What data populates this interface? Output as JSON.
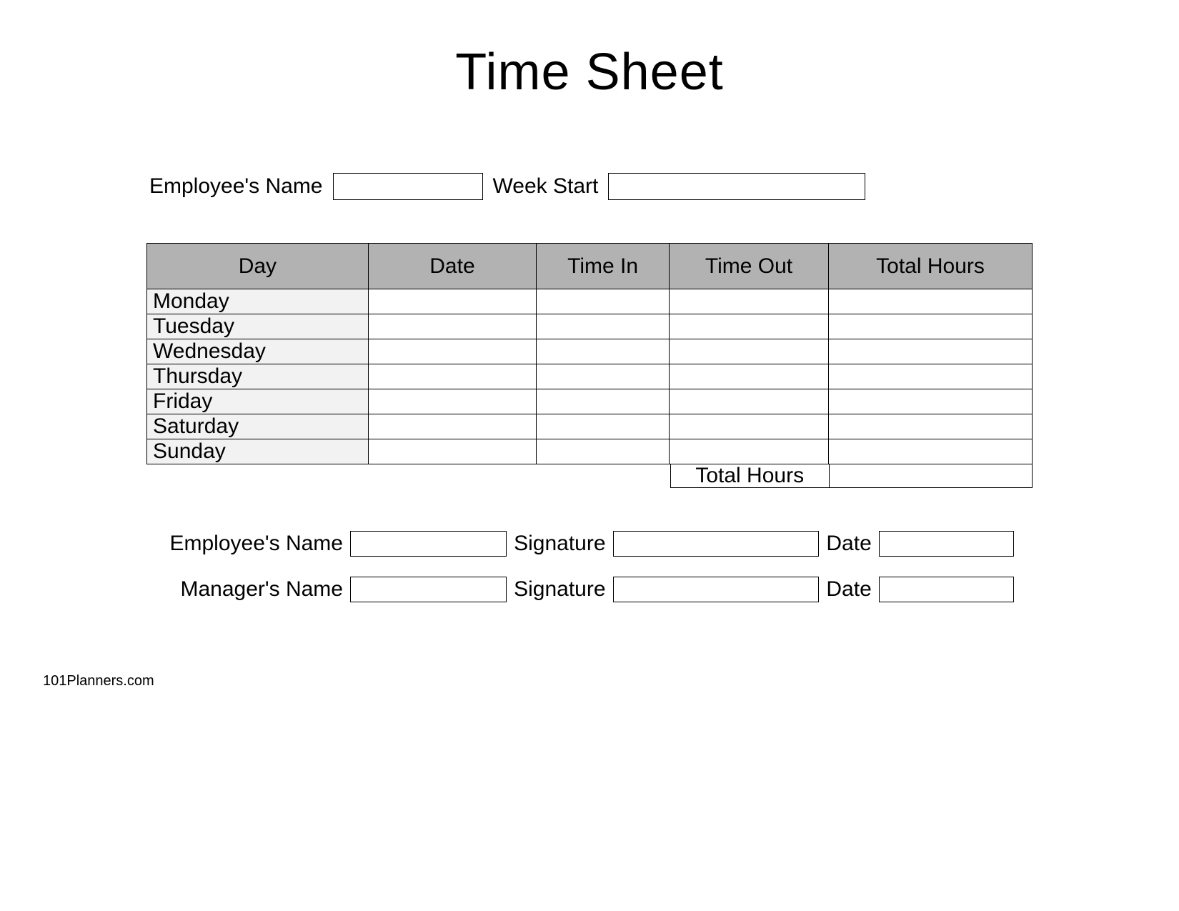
{
  "title": "Time Sheet",
  "header": {
    "employee_name_label": "Employee's Name",
    "week_start_label": "Week Start"
  },
  "table": {
    "columns": {
      "day": "Day",
      "date": "Date",
      "time_in": "Time In",
      "time_out": "Time Out",
      "total_hours": "Total Hours"
    },
    "days": [
      "Monday",
      "Tuesday",
      "Wednesday",
      "Thursday",
      "Friday",
      "Saturday",
      "Sunday"
    ],
    "totals_label": "Total Hours"
  },
  "signoff": {
    "employee_name_label": "Employee's Name",
    "manager_name_label": "Manager's Name",
    "signature_label": "Signature",
    "date_label": "Date"
  },
  "attribution": "101Planners.com"
}
